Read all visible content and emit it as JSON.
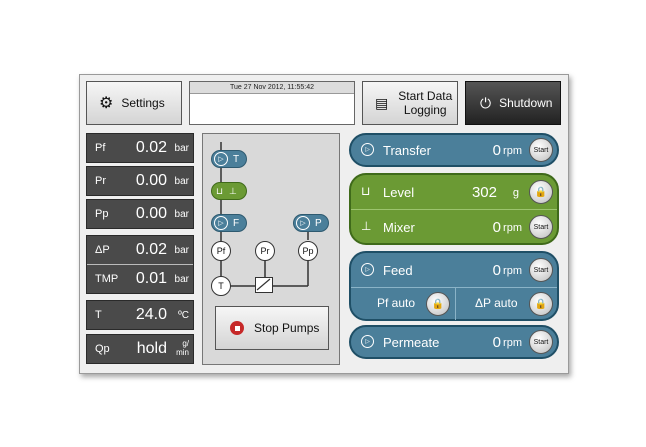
{
  "toolbar": {
    "settings_label": "Settings",
    "datetime": "Tue 27 Nov 2012, 11:55:42",
    "logging_label_1": "Start Data",
    "logging_label_2": "Logging",
    "shutdown_label": "Shutdown"
  },
  "readouts": [
    {
      "label": "Pf",
      "value": "0.02",
      "unit": "bar"
    },
    {
      "label": "Pr",
      "value": "0.00",
      "unit": "bar"
    },
    {
      "label": "Pp",
      "value": "0.00",
      "unit": "bar"
    },
    {
      "label": "ΔP",
      "value": "0.02",
      "unit": "bar"
    },
    {
      "label": "TMP",
      "value": "0.01",
      "unit": "bar"
    },
    {
      "label": "T",
      "value": "24.0",
      "unit": "ºC"
    },
    {
      "label": "Qp",
      "value": "hold",
      "unit_top": "g/",
      "unit_bottom": "min"
    }
  ],
  "process": {
    "pump_t": "T",
    "pump_f": "F",
    "pump_p": "P",
    "sensor_pf": "Pf",
    "sensor_pr": "Pr",
    "sensor_pp": "Pp",
    "sensor_t": "T",
    "stop_label": "Stop Pumps"
  },
  "controls": {
    "transfer": {
      "name": "Transfer",
      "value": "0",
      "unit": "rpm",
      "button": "Start"
    },
    "level": {
      "name": "Level",
      "value": "302",
      "unit": "g"
    },
    "mixer": {
      "name": "Mixer",
      "value": "0",
      "unit": "rpm",
      "button": "Start"
    },
    "feed": {
      "name": "Feed",
      "value": "0",
      "unit": "rpm",
      "button": "Start"
    },
    "pf_auto": "Pf auto",
    "dp_auto": "ΔP auto",
    "permeate": {
      "name": "Permeate",
      "value": "0",
      "unit": "rpm",
      "button": "Start"
    }
  },
  "colors": {
    "panel_blue": "#4b7f9a",
    "panel_green": "#6b9a34",
    "stop_red": "#c62828"
  }
}
